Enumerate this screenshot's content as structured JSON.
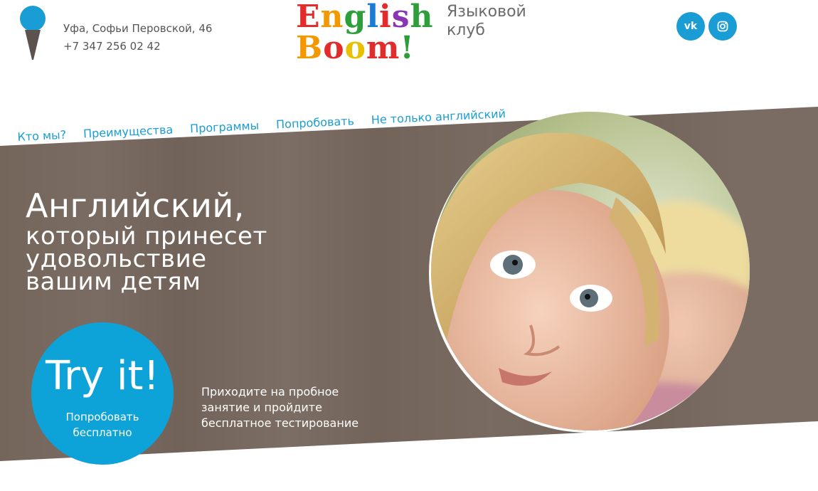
{
  "header": {
    "address": "Уфа, Софьи Перовской, 46",
    "phone": "+7 347 256 02 42",
    "logo_line1": "English",
    "logo_line2": "Boom!",
    "club_line1": "Языковой",
    "club_line2": "клуб",
    "social": [
      {
        "name": "vk",
        "label": "vk"
      },
      {
        "name": "instagram",
        "label": "◎"
      }
    ]
  },
  "nav": {
    "items": [
      {
        "label": "Кто мы?"
      },
      {
        "label": "Преимущества"
      },
      {
        "label": "Программы"
      },
      {
        "label": "Попробовать"
      },
      {
        "label": "Не только английский"
      }
    ]
  },
  "hero": {
    "line1": "Английский,",
    "line2": "который принесет",
    "line3": "удовольствие",
    "line4": "вашим детям",
    "cta_big": "Try it!",
    "cta_small_1": "Попробовать",
    "cta_small_2": "бесплатно",
    "promo_1": "Приходите на пробное",
    "promo_2": "занятие и пройдите",
    "promo_3": "бесплатное тестирование"
  },
  "colors": {
    "accent": "#1a9dd4",
    "band": "#75665c",
    "cta": "#0ea3d8"
  },
  "icons": {
    "location": "ice-cream-pin-icon",
    "vk": "vk-icon",
    "instagram": "instagram-icon"
  }
}
